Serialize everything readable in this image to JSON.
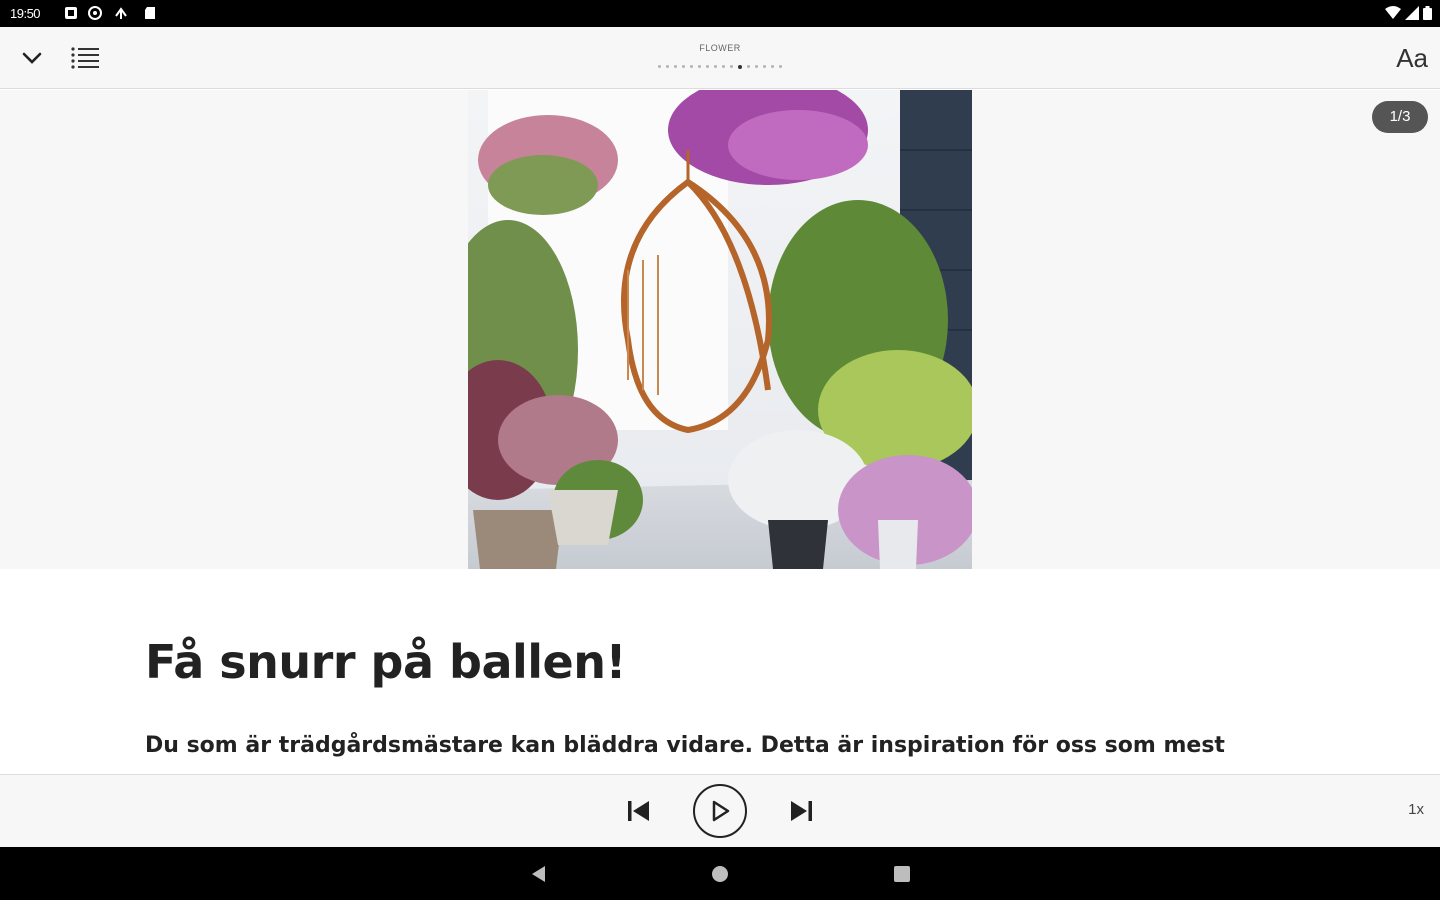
{
  "status_bar": {
    "time": "19:50"
  },
  "toolbar": {
    "section": "FLOWER",
    "dot_count": 16,
    "active_dot": 10,
    "font_button": "Aa"
  },
  "hero": {
    "counter": "1/3"
  },
  "article": {
    "title": "Få snurr på ballen!",
    "lead": "Du som är trädgårdsmästare kan bläddra vidare. Detta är inspiration för oss som mest"
  },
  "player": {
    "speed": "1x"
  }
}
